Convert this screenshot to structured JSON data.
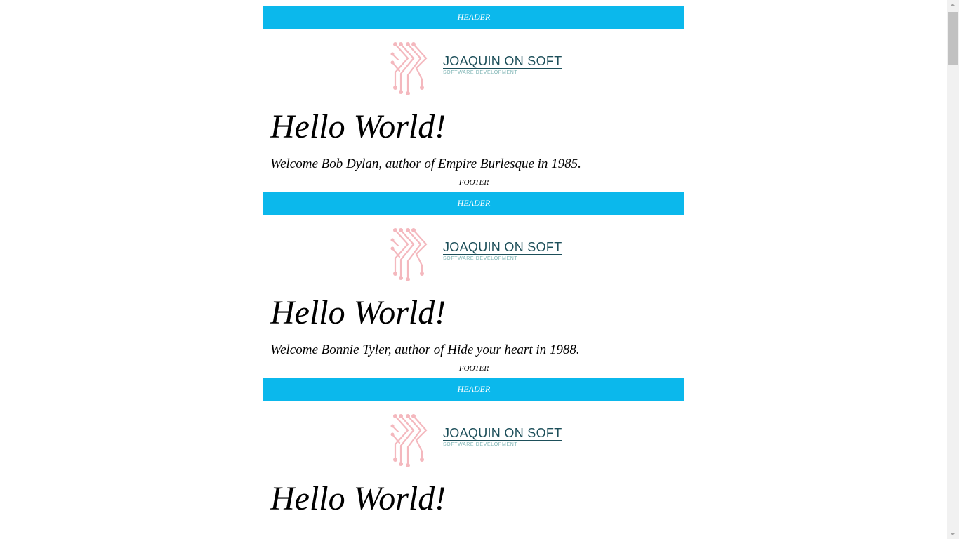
{
  "blocks": [
    {
      "header": "HEADER",
      "logo": {
        "title": "JOAQUIN ON SOFT",
        "subtitle": "SOFTWARE DEVELOPMENT"
      },
      "title": "Hello World!",
      "message": "Welcome Bob Dylan, author of Empire Burlesque in 1985.",
      "footer": "FOOTER"
    },
    {
      "header": "HEADER",
      "logo": {
        "title": "JOAQUIN ON SOFT",
        "subtitle": "SOFTWARE DEVELOPMENT"
      },
      "title": "Hello World!",
      "message": "Welcome Bonnie Tyler, author of Hide your heart in 1988.",
      "footer": "FOOTER"
    },
    {
      "header": "HEADER",
      "logo": {
        "title": "JOAQUIN ON SOFT",
        "subtitle": "SOFTWARE DEVELOPMENT"
      },
      "title": "Hello World!",
      "message": "",
      "footer": ""
    }
  ],
  "colors": {
    "header_bg": "#0bb8ec",
    "logo_text": "#1d4f5a",
    "logo_mark": "#f4b8be"
  },
  "icons": {
    "logo_mark": "circuit-k-icon",
    "scroll_up": "triangle-up-icon",
    "scroll_down": "triangle-down-icon"
  }
}
